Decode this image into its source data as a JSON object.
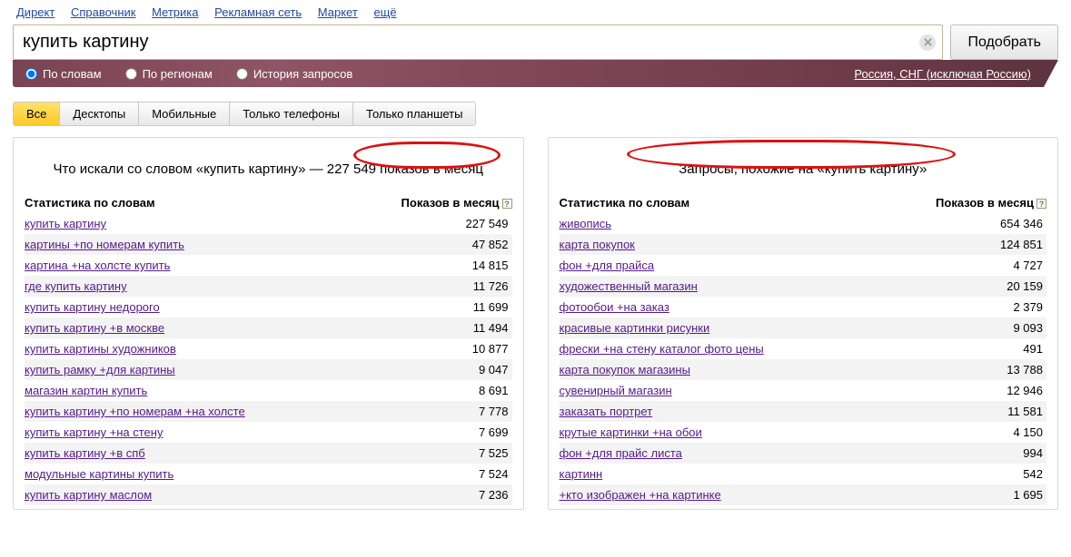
{
  "nav": {
    "items": [
      "Директ",
      "Справочник",
      "Метрика",
      "Рекламная сеть",
      "Маркет",
      "ещё"
    ]
  },
  "search": {
    "value": "купить картину",
    "button": "Подобрать"
  },
  "filters": {
    "r0": "По словам",
    "r1": "По регионам",
    "r2": "История запросов",
    "region": "Россия, СНГ (исключая Россию)"
  },
  "tabs": [
    "Все",
    "Десктопы",
    "Мобильные",
    "Только телефоны",
    "Только планшеты"
  ],
  "left": {
    "title_pre": "Что искали со словом «купить картину» — ",
    "title_mid": "227 549 показов",
    "title_post": " в месяц",
    "col0": "Статистика по словам",
    "col1": "Показов в месяц",
    "rows": [
      {
        "k": "купить картину",
        "v": "227 549"
      },
      {
        "k": "картины +по номерам купить",
        "v": "47 852"
      },
      {
        "k": "картина +на холсте купить",
        "v": "14 815"
      },
      {
        "k": "где купить картину",
        "v": "11 726"
      },
      {
        "k": "купить картину недорого",
        "v": "11 699"
      },
      {
        "k": "купить картину +в москве",
        "v": "11 494"
      },
      {
        "k": "купить картины художников",
        "v": "10 877"
      },
      {
        "k": "купить рамку +для картины",
        "v": "9 047"
      },
      {
        "k": "магазин картин купить",
        "v": "8 691"
      },
      {
        "k": "купить картину +по номерам +на холсте",
        "v": "7 778"
      },
      {
        "k": "купить картину +на стену",
        "v": "7 699"
      },
      {
        "k": "купить картину +в спб",
        "v": "7 525"
      },
      {
        "k": "модульные картины купить",
        "v": "7 524"
      },
      {
        "k": "купить картину маслом",
        "v": "7 236"
      }
    ]
  },
  "right": {
    "title": "Запросы, похожие на «купить картину»",
    "col0": "Статистика по словам",
    "col1": "Показов в месяц",
    "rows": [
      {
        "k": "живопись",
        "v": "654 346"
      },
      {
        "k": "карта покупок",
        "v": "124 851"
      },
      {
        "k": "фон +для прайса",
        "v": "4 727"
      },
      {
        "k": "художественный магазин",
        "v": "20 159"
      },
      {
        "k": "фотообои +на заказ",
        "v": "2 379"
      },
      {
        "k": "красивые картинки рисунки",
        "v": "9 093"
      },
      {
        "k": "фрески +на стену каталог фото цены",
        "v": "491"
      },
      {
        "k": "карта покупок магазины",
        "v": "13 788"
      },
      {
        "k": "сувенирный магазин",
        "v": "12 946"
      },
      {
        "k": "заказать портрет",
        "v": "11 581"
      },
      {
        "k": "крутые картинки +на обои",
        "v": "4 150"
      },
      {
        "k": "фон +для прайс листа",
        "v": "994"
      },
      {
        "k": "картинн",
        "v": "542"
      },
      {
        "k": "+кто изображен +на картинке",
        "v": "1 695"
      }
    ]
  }
}
